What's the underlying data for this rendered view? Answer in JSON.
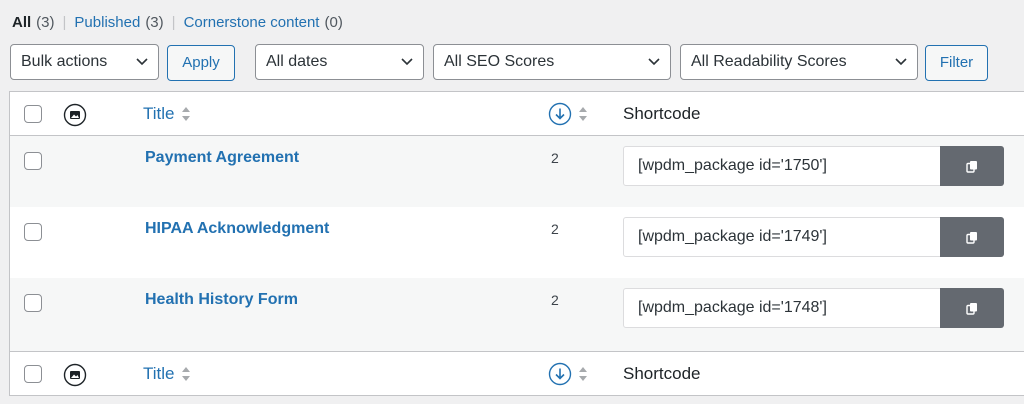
{
  "filters": {
    "all_label": "All",
    "all_count": "(3)",
    "published_label": "Published",
    "published_count": "(3)",
    "cornerstone_label": "Cornerstone content",
    "cornerstone_count": "(0)",
    "separator": "|"
  },
  "toolbar": {
    "bulk_actions": "Bulk actions",
    "apply": "Apply",
    "dates": "All dates",
    "seo_scores": "All SEO Scores",
    "readability_scores": "All Readability Scores",
    "filter": "Filter"
  },
  "columns": {
    "title": "Title",
    "shortcode": "Shortcode"
  },
  "rows": [
    {
      "title": "Payment Agreement",
      "views": "2",
      "shortcode": "[wpdm_package id='1750']"
    },
    {
      "title": "HIPAA Acknowledgment",
      "views": "2",
      "shortcode": "[wpdm_package id='1749']"
    },
    {
      "title": "Health History Form",
      "views": "2",
      "shortcode": "[wpdm_package id='1748']"
    }
  ],
  "icons": {
    "chevron": "chevron-down-icon",
    "image": "image-icon",
    "sort": "sort-arrows-icon",
    "views": "circle-down-arrow-icon",
    "copy": "copy-icon"
  },
  "colors": {
    "link": "#2271b1",
    "copy_button": "#646970",
    "row_alt": "#f6f7f7",
    "background": "#f0f0f1"
  }
}
